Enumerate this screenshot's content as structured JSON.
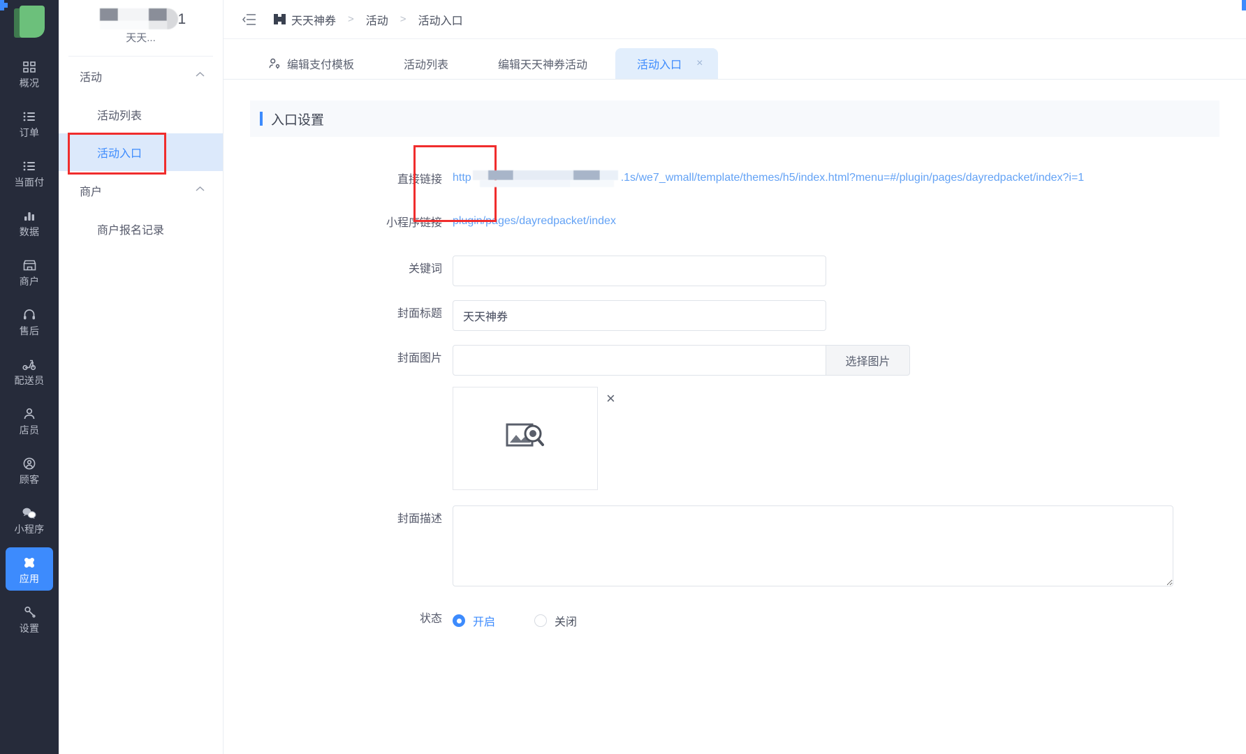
{
  "rail": {
    "logo_name": "leaf-logo",
    "items": [
      {
        "label": "概况",
        "icon": "dashboard-icon",
        "active": false
      },
      {
        "label": "订单",
        "icon": "list-icon",
        "active": false
      },
      {
        "label": "当面付",
        "icon": "list-icon",
        "active": false
      },
      {
        "label": "数据",
        "icon": "bar-chart-icon",
        "active": false
      },
      {
        "label": "商户",
        "icon": "shop-icon",
        "active": false
      },
      {
        "label": "售后",
        "icon": "headset-icon",
        "active": false
      },
      {
        "label": "配送员",
        "icon": "scooter-icon",
        "active": false
      },
      {
        "label": "店员",
        "icon": "staff-icon",
        "active": false
      },
      {
        "label": "顾客",
        "icon": "customer-icon",
        "active": false
      },
      {
        "label": "小程序",
        "icon": "wechat-icon",
        "active": false
      },
      {
        "label": "应用",
        "icon": "apps-icon",
        "active": true
      },
      {
        "label": "设置",
        "icon": "settings-icon",
        "active": false
      }
    ]
  },
  "subnav": {
    "brand_number": "1",
    "brand_sub": "天天...",
    "groups": [
      {
        "title": "活动",
        "items": [
          {
            "label": "活动列表",
            "active": false,
            "highlight": false
          },
          {
            "label": "活动入口",
            "active": true,
            "highlight": true
          }
        ]
      },
      {
        "title": "商户",
        "items": [
          {
            "label": "商户报名记录",
            "active": false,
            "highlight": false
          }
        ]
      }
    ]
  },
  "breadcrumb": {
    "collapse_icon": "collapse-menu-icon",
    "items": [
      "天天神券",
      "活动",
      "活动入口"
    ],
    "separator": ">"
  },
  "tabs": [
    {
      "label": "编辑支付模板",
      "icon": "person-key-icon",
      "active": false,
      "closable": false
    },
    {
      "label": "活动列表",
      "icon": "app-icon",
      "active": false,
      "closable": false
    },
    {
      "label": "编辑天天神券活动",
      "icon": "app-icon",
      "active": false,
      "closable": false
    },
    {
      "label": "活动入口",
      "icon": "app-icon",
      "active": true,
      "closable": true,
      "close_glyph": "×"
    }
  ],
  "panel": {
    "title": "入口设置"
  },
  "form": {
    "direct_link": {
      "label": "直接链接",
      "prefix": "http",
      "suffix": ".1s/we7_wmall/template/themes/h5/index.html?menu=#/plugin/pages/dayredpacket/index?i=1"
    },
    "miniprogram_link": {
      "label": "小程序链接",
      "value": "plugin/pages/dayredpacket/index"
    },
    "keyword": {
      "label": "关键词",
      "value": "",
      "placeholder": ""
    },
    "cover_title": {
      "label": "封面标题",
      "value": "天天神券",
      "placeholder": ""
    },
    "cover_image": {
      "label": "封面图片",
      "value": "",
      "placeholder": "",
      "button_label": "选择图片",
      "thumb_icon": "image-search-icon",
      "remove_glyph": "×"
    },
    "cover_desc": {
      "label": "封面描述",
      "value": "",
      "placeholder": ""
    },
    "status": {
      "label": "状态",
      "options": [
        {
          "label": "开启",
          "selected": true
        },
        {
          "label": "关闭",
          "selected": false
        }
      ]
    }
  },
  "colors": {
    "rail_bg": "#262b3a",
    "accent": "#3d8bfd",
    "active_nav_bg": "#dce9fb",
    "highlight_box": "#f02d2d",
    "link_text": "#63a2f5",
    "panel_head_bg": "#f7f9fc"
  }
}
